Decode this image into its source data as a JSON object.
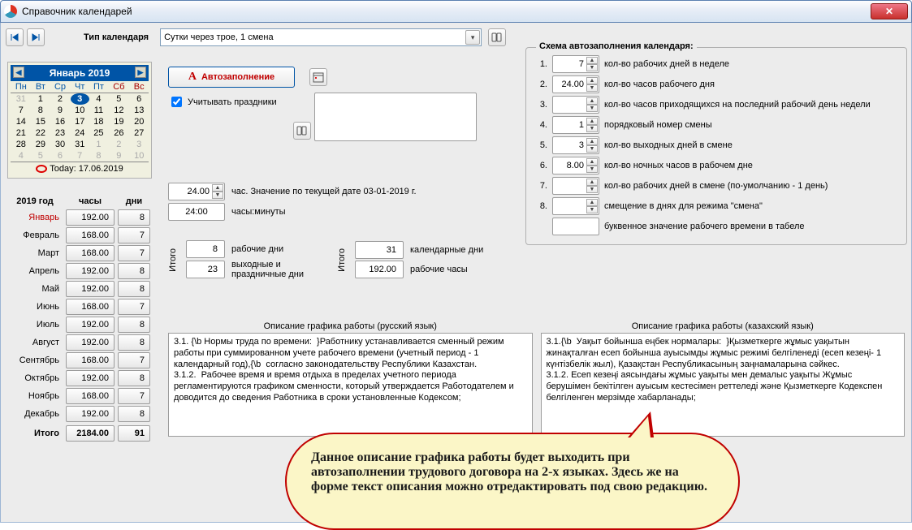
{
  "window": {
    "title": "Справочник календарей"
  },
  "toolbar": {
    "type_label": "Тип календаря",
    "type_value": "Сутки через трое, 1 смена"
  },
  "calendar": {
    "month_label": "Январь 2019",
    "dow": [
      "Пн",
      "Вт",
      "Ср",
      "Чт",
      "Пт",
      "Сб",
      "Вс"
    ],
    "grid": [
      [
        "31",
        "1",
        "2",
        "3",
        "4",
        "5",
        "6"
      ],
      [
        "7",
        "8",
        "9",
        "10",
        "11",
        "12",
        "13"
      ],
      [
        "14",
        "15",
        "16",
        "17",
        "18",
        "19",
        "20"
      ],
      [
        "21",
        "22",
        "23",
        "24",
        "25",
        "26",
        "27"
      ],
      [
        "28",
        "29",
        "30",
        "31",
        "1",
        "2",
        "3"
      ],
      [
        "4",
        "5",
        "6",
        "7",
        "8",
        "9",
        "10"
      ]
    ],
    "dim_first": [
      true,
      false,
      false,
      false,
      false,
      false,
      false
    ],
    "dim_r5": [
      false,
      false,
      false,
      false,
      true,
      true,
      true
    ],
    "dim_r6": [
      true,
      true,
      true,
      true,
      true,
      true,
      true
    ],
    "today_pos": {
      "r": 0,
      "c": 3
    },
    "today_label": "Today: 17.06.2019"
  },
  "yeartable": {
    "year_label": "2019 год",
    "hours_label": "часы",
    "days_label": "дни",
    "rows": [
      {
        "m": "Январь",
        "h": "192.00",
        "d": "8",
        "cur": true
      },
      {
        "m": "Февраль",
        "h": "168.00",
        "d": "7"
      },
      {
        "m": "Март",
        "h": "168.00",
        "d": "7"
      },
      {
        "m": "Апрель",
        "h": "192.00",
        "d": "8"
      },
      {
        "m": "Май",
        "h": "192.00",
        "d": "8"
      },
      {
        "m": "Июнь",
        "h": "168.00",
        "d": "7"
      },
      {
        "m": "Июль",
        "h": "192.00",
        "d": "8"
      },
      {
        "m": "Август",
        "h": "192.00",
        "d": "8"
      },
      {
        "m": "Сентябрь",
        "h": "168.00",
        "d": "7"
      },
      {
        "m": "Октябрь",
        "h": "192.00",
        "d": "8"
      },
      {
        "m": "Ноябрь",
        "h": "168.00",
        "d": "7"
      },
      {
        "m": "Декабрь",
        "h": "192.00",
        "d": "8"
      }
    ],
    "total_label": "Итого",
    "total_hours": "2184.00",
    "total_days": "91"
  },
  "mid": {
    "autofill_label": "Автозаполнение",
    "holidays_label": "Учитывать праздники",
    "hours_value": "24.00",
    "hours_suffix": "час. Значение по текущей дате 03-01-2019 г.",
    "hm_value": "24:00",
    "hm_suffix": "часы:минуты",
    "itog_label": "Итого",
    "work_days": "8",
    "work_days_label": "рабочие дни",
    "off_days": "23",
    "off_days_label": "выходные и праздничные дни",
    "cal_days": "31",
    "cal_days_label": "календарные дни",
    "work_hours": "192.00",
    "work_hours_label": "рабочие часы"
  },
  "scheme": {
    "legend": "Схема автозаполнения календаря:",
    "rows": [
      {
        "n": "1.",
        "v": "7",
        "lbl": "кол-во рабочих дней в неделе",
        "spin": true
      },
      {
        "n": "2.",
        "v": "24.00",
        "lbl": "кол-во часов рабочего дня",
        "spin": true
      },
      {
        "n": "3.",
        "v": "",
        "lbl": "кол-во часов приходящихся на последний рабочий день недели",
        "spin": true
      },
      {
        "n": "4.",
        "v": "1",
        "lbl": "порядковый номер смены",
        "spin": true
      },
      {
        "n": "5.",
        "v": "3",
        "lbl": "кол-во выходных дней в смене",
        "spin": true
      },
      {
        "n": "6.",
        "v": "8.00",
        "lbl": "кол-во ночных часов в рабочем дне",
        "spin": true
      },
      {
        "n": "7.",
        "v": "",
        "lbl": "кол-во рабочих дней в смене (по-умолчанию - 1 день)",
        "spin": true
      },
      {
        "n": "8.",
        "v": "",
        "lbl": "смещение в днях для режима \"смена\"",
        "spin": true
      },
      {
        "n": "",
        "v": "",
        "lbl": "буквенное значение рабочего времени в табеле",
        "spin": false
      }
    ]
  },
  "desc": {
    "hdr_ru": "Описание графика работы (русский язык)",
    "hdr_kz": "Описание графика работы (казахский язык)",
    "ru": "3.1. {\\b Нормы труда по времени:  }Работнику устанавливается сменный режим работы при суммированном учете рабочего времени (учетный период - 1 календарный год),{\\b  согласно законодательству Республики Казахстан.\n3.1.2.  Рабочее время и время отдыха в пределах учетного периода регламентируются графиком сменности, который утверждается Работодателем и доводится до сведения Работника в сроки установленные Кодексом;",
    "kz": "3.1.{\\b  Уақыт бойынша еңбек нормалары:  }Қызметкерге жұмыс уақытын жинақталған есеп бойынша ауысымды жұмыс режимі белгіленеді (есеп кезеңі- 1 күнтізбелік жыл), Қазақстан Республикасының заңнамаларына сәйкес.\n3.1.2. Есеп кезеңі аясындағы жұмыс уақыты мен демалыс уақыты Жұмыс берушімен бекітілген ауысым кестесімен реттеледі және Қызметкерге Кодекспен белгіленген мерзімде хабарланады;"
  },
  "callout": "Данное описание графика работы будет выходить при автозаполнении трудового договора на 2-х языках. Здесь же на форме текст описания можно отредактировать под свою редакцию."
}
